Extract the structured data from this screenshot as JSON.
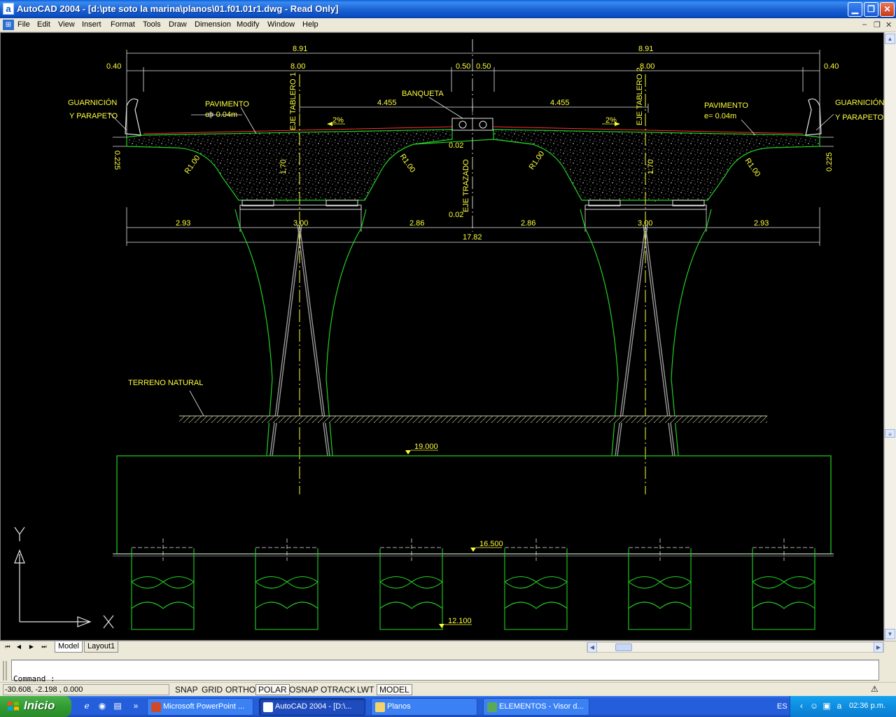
{
  "window": {
    "title": "AutoCAD 2004 - [d:\\pte soto la marina\\planos\\01.f01.01r1.dwg - Read Only]",
    "app_icon": "a"
  },
  "menu": {
    "items": [
      "File",
      "Edit",
      "View",
      "Insert",
      "Format",
      "Tools",
      "Draw",
      "Dimension",
      "Modify",
      "Window",
      "Help"
    ]
  },
  "drawing": {
    "dims": {
      "d891_left": "8.91",
      "d891_right": "8.91",
      "d040_left": "0.40",
      "d040_right": "0.40",
      "d800_left": "8.00",
      "d800_right": "8.00",
      "d050_left": "0.50",
      "d050_right": "0.50",
      "d4455_left": "4.455",
      "d4455_right": "4.455",
      "slope_left": "2%",
      "slope_right": "2%",
      "d002_top": "0.02",
      "d002_bot": "0.02",
      "d0225_left": "0.225",
      "d0225_right": "0.225",
      "d170_left": "1.70",
      "d170_right": "1.70",
      "r_left1": "R1.00",
      "r_left2": "R1.00",
      "r_right1": "R1.00",
      "r_right2": "R1.00",
      "d293_left": "2.93",
      "d300_left": "3.00",
      "d286_left": "2.86",
      "d286_right": "2.86",
      "d300_right": "3.00",
      "d293_right": "2.93",
      "total": "17.82"
    },
    "labels": {
      "guarnicion_l1": "GUARNICIÓN",
      "guarnicion_l2": "Y PARAPETO",
      "guarnicion_r1": "GUARNICIÓN",
      "guarnicion_r2": "Y PARAPETO",
      "pavimento_l1": "PAVIMENTO",
      "pavimento_l2": "e= 0.04m",
      "pavimento_r1": "PAVIMENTO",
      "pavimento_r2": "e= 0.04m",
      "banqueta": "BANQUETA",
      "eje_tablero1": "EJE TABLERO 1",
      "eje_tablero2": "EJE TABLERO 2",
      "eje_trazado": "EJE TRAZADO",
      "terreno": "TERRENO NATURAL",
      "elev_top": "19.000",
      "elev_mid": "16.500",
      "elev_bot": "12.100"
    },
    "ucs": {
      "y": "Y",
      "x": "X"
    },
    "colors": {
      "green": "#21d121",
      "yellow": "#ffff3c",
      "white": "#e6e6e6",
      "red": "#ff3030",
      "gray": "#9a9a9a"
    }
  },
  "tabs": {
    "model": "Model",
    "layout": "Layout1"
  },
  "command": {
    "prompt": "Command :"
  },
  "status": {
    "coords": "-30.608, -2.198 , 0.000",
    "buttons": [
      "SNAP",
      "GRID",
      "ORTHO",
      "POLAR",
      "OSNAP",
      "OTRACK",
      "LWT",
      "MODEL"
    ],
    "active": [
      "POLAR",
      "MODEL"
    ]
  },
  "taskbar": {
    "start": "Inicio",
    "tasks": [
      {
        "label": "Microsoft PowerPoint ...",
        "active": false
      },
      {
        "label": "AutoCAD 2004 - [D:\\...",
        "active": true
      },
      {
        "label": "Planos",
        "active": false
      },
      {
        "label": "ELEMENTOS - Visor d...",
        "active": false
      }
    ],
    "lang": "ES",
    "clock": "02:36 p.m."
  }
}
